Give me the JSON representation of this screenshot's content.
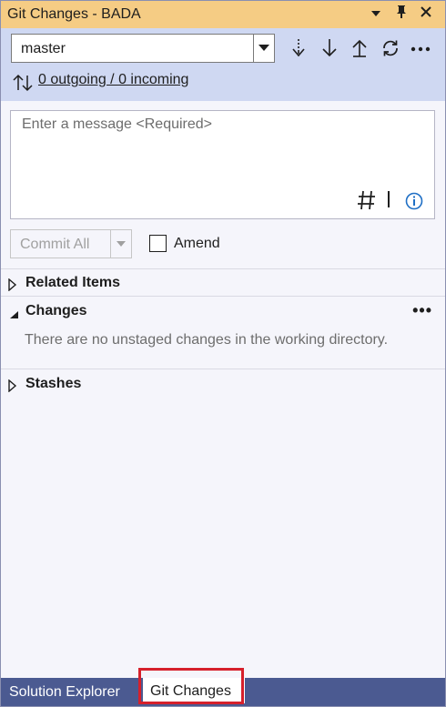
{
  "window": {
    "title": "Git Changes - BADA",
    "controls": {
      "dropdown": "▼",
      "pin": "📌",
      "close": "✕"
    }
  },
  "toolbar": {
    "branch": "master",
    "actions": [
      "fetch-icon",
      "pull-icon",
      "push-icon",
      "sync-icon",
      "more-icon"
    ],
    "sync_status": "0 outgoing / 0 incoming"
  },
  "message": {
    "placeholder": "Enter a message <Required>",
    "value": ""
  },
  "commit": {
    "label": "Commit All",
    "amend_label": "Amend",
    "amend_checked": false
  },
  "sections": {
    "related": {
      "label": "Related Items",
      "expanded": false
    },
    "changes": {
      "label": "Changes",
      "expanded": true,
      "empty_text": "There are no unstaged changes in the working directory.",
      "more": "•••"
    },
    "stashes": {
      "label": "Stashes",
      "expanded": false
    }
  },
  "tabs": {
    "solution_explorer": "Solution Explorer",
    "git_changes": "Git Changes",
    "active": "Git Changes"
  },
  "colors": {
    "title_bar": "#f5cc84",
    "header": "#cfd8f2",
    "tab_bar": "#4b5a91",
    "highlight": "#d6202b",
    "info_blue": "#1f6fc5"
  }
}
